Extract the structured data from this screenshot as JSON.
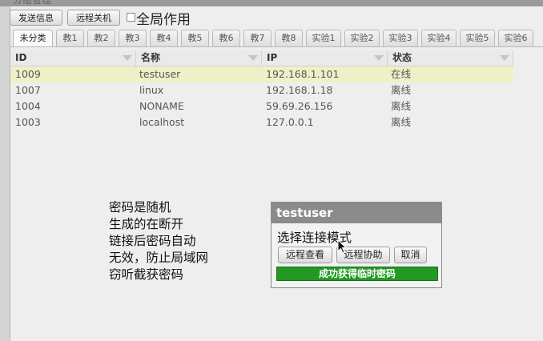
{
  "window": {
    "title": "分组管理"
  },
  "toolbar": {
    "send_message": "发送信息",
    "remote_shutdown": "远程关机",
    "global_scope_label": "全局作用",
    "global_scope_checked": false
  },
  "tabs": [
    {
      "label": "未分类",
      "active": true
    },
    {
      "label": "教1"
    },
    {
      "label": "教2"
    },
    {
      "label": "教3"
    },
    {
      "label": "教4"
    },
    {
      "label": "教5"
    },
    {
      "label": "教6"
    },
    {
      "label": "教7"
    },
    {
      "label": "教8"
    },
    {
      "label": "实验1"
    },
    {
      "label": "实验2"
    },
    {
      "label": "实验3"
    },
    {
      "label": "实验4"
    },
    {
      "label": "实验5"
    },
    {
      "label": "实验6"
    }
  ],
  "table": {
    "columns": [
      "ID",
      "名称",
      "IP",
      "状态"
    ],
    "rows": [
      {
        "id": "1009",
        "name": "testuser",
        "ip": "192.168.1.101",
        "status": "在线",
        "selected": true
      },
      {
        "id": "1007",
        "name": "linux",
        "ip": "192.168.1.18",
        "status": "离线"
      },
      {
        "id": "1004",
        "name": "NONAME",
        "ip": "59.69.26.156",
        "status": "离线"
      },
      {
        "id": "1003",
        "name": "localhost",
        "ip": "127.0.0.1",
        "status": "离线"
      }
    ]
  },
  "annotation": {
    "text": "密码是随机\n生成的在断开\n链接后密码自动\n无效，防止局域网\n窃听截获密码"
  },
  "dialog": {
    "title": "testuser",
    "prompt": "选择连接模式",
    "remote_view": "远程查看",
    "remote_assist": "远程协助",
    "cancel": "取消",
    "status_message": "成功获得临时密码",
    "status_color": "#229922"
  },
  "colors": {
    "selected_row": "#f0f0c8",
    "dialog_header": "#8b8b8b"
  }
}
